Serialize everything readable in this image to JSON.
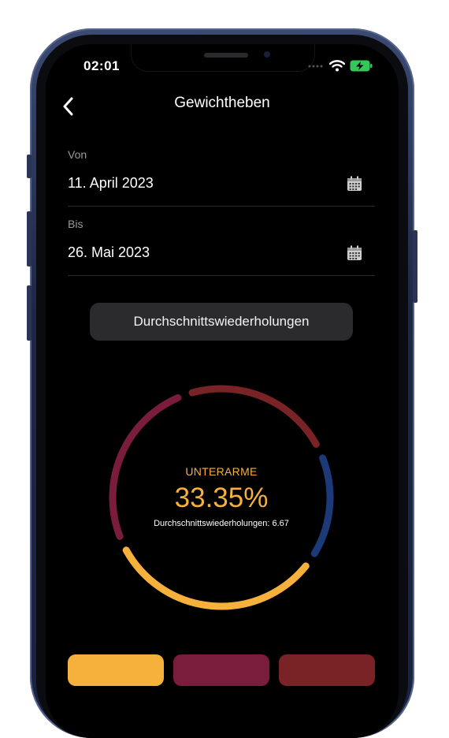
{
  "status_bar": {
    "time": "02:01"
  },
  "nav": {
    "title": "Gewichtheben"
  },
  "from": {
    "label": "Von",
    "value": "11. April 2023"
  },
  "to": {
    "label": "Bis",
    "value": "26. Mai 2023"
  },
  "metric_button": {
    "label": "Durchschnittswiederholungen"
  },
  "highlight": {
    "category": "UNTERARME",
    "percent": "33.35%",
    "subtitle": "Durchschnittswiederholungen: 6.67"
  },
  "colors": {
    "yellow": "#f6b13c",
    "maroon": "#7a1c3c",
    "red": "#7a2326",
    "blue": "#1d3a78"
  },
  "chart_data": {
    "type": "donut",
    "series": [
      {
        "color": "#f6b13c",
        "value": 33.35
      },
      {
        "color": "#7a1c3c",
        "value": 26.5
      },
      {
        "color": "#7a2326",
        "value": 23.4
      },
      {
        "color": "#1d3a78",
        "value": 16.75
      }
    ]
  },
  "legend_tiles": [
    "#f6b13c",
    "#7a1c3c",
    "#7a2326"
  ]
}
